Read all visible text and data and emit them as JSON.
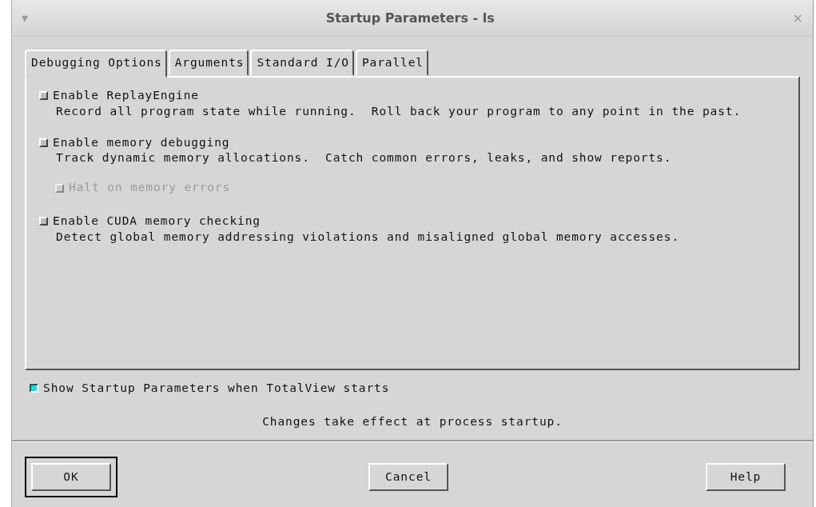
{
  "window": {
    "title": "Startup Parameters - ls",
    "menu_glyph": "▾",
    "close_glyph": "×"
  },
  "tabs": [
    {
      "label": "Debugging Options",
      "selected": true
    },
    {
      "label": "Arguments",
      "selected": false
    },
    {
      "label": "Standard I/O",
      "selected": false
    },
    {
      "label": "Parallel",
      "selected": false
    }
  ],
  "options": [
    {
      "label": "Enable ReplayEngine",
      "checked": false,
      "disabled": false,
      "description": "Record all program state while running.  Roll back your program to any point in the past."
    },
    {
      "label": "Enable memory debugging",
      "checked": false,
      "disabled": false,
      "description": "Track dynamic memory allocations.  Catch common errors, leaks, and show reports.",
      "children": [
        {
          "label": "Halt on memory errors",
          "checked": false,
          "disabled": true
        }
      ]
    },
    {
      "label": "Enable CUDA memory checking",
      "checked": false,
      "disabled": false,
      "description": "Detect global memory addressing violations and misaligned global memory accesses."
    }
  ],
  "show_startup": {
    "label": "Show Startup Parameters when TotalView starts",
    "checked": true
  },
  "status": "Changes take effect at process startup.",
  "buttons": [
    {
      "label": "OK",
      "default": true
    },
    {
      "label": "Cancel",
      "default": false
    },
    {
      "label": "Help",
      "default": false
    }
  ]
}
